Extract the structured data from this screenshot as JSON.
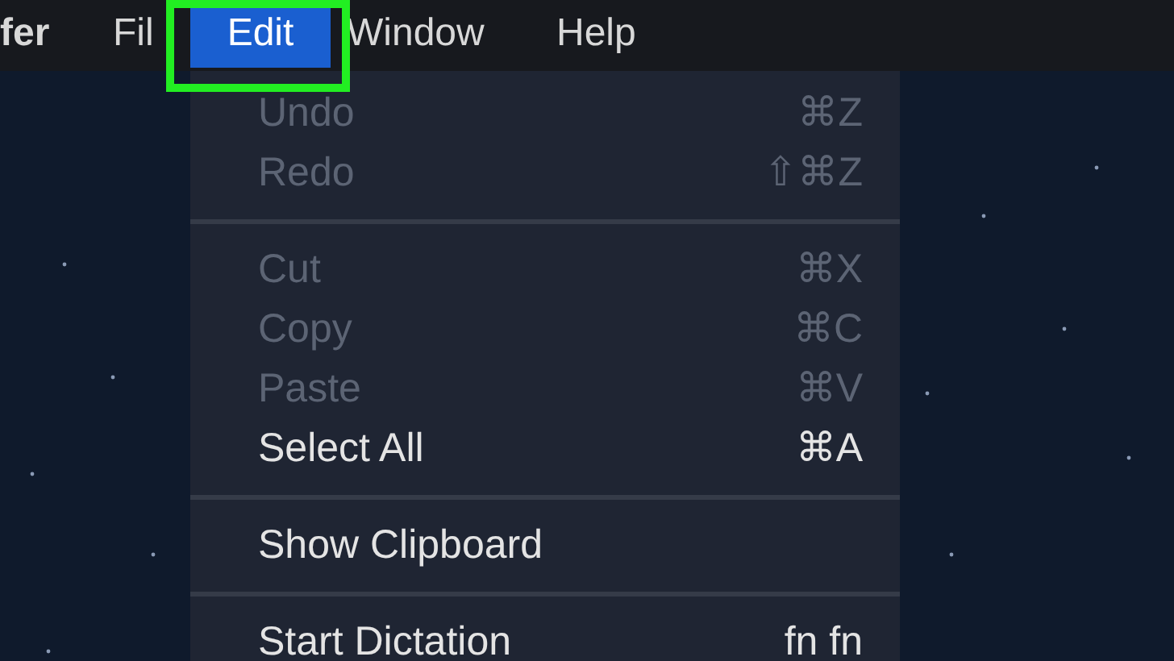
{
  "menu_bar": [
    {
      "label": "fer",
      "selected": false,
      "kind": "app"
    },
    {
      "label": "Fil",
      "selected": false,
      "kind": "menu"
    },
    {
      "label": "Edit",
      "selected": true,
      "kind": "menu"
    },
    {
      "label": "Window",
      "selected": false,
      "kind": "menu"
    },
    {
      "label": "Help",
      "selected": false,
      "kind": "menu"
    }
  ],
  "edit_menu": {
    "groups": [
      [
        {
          "label": "Undo",
          "shortcut": "⌘Z",
          "disabled": true
        },
        {
          "label": "Redo",
          "shortcut": "⇧⌘Z",
          "disabled": true
        }
      ],
      [
        {
          "label": "Cut",
          "shortcut": "⌘X",
          "disabled": true
        },
        {
          "label": "Copy",
          "shortcut": "⌘C",
          "disabled": true
        },
        {
          "label": "Paste",
          "shortcut": "⌘V",
          "disabled": true
        },
        {
          "label": "Select All",
          "shortcut": "⌘A",
          "disabled": false
        }
      ],
      [
        {
          "label": "Show Clipboard",
          "disabled": false
        }
      ],
      [
        {
          "label": "Start Dictation",
          "shortcut": "fn fn",
          "disabled": false
        }
      ]
    ]
  }
}
